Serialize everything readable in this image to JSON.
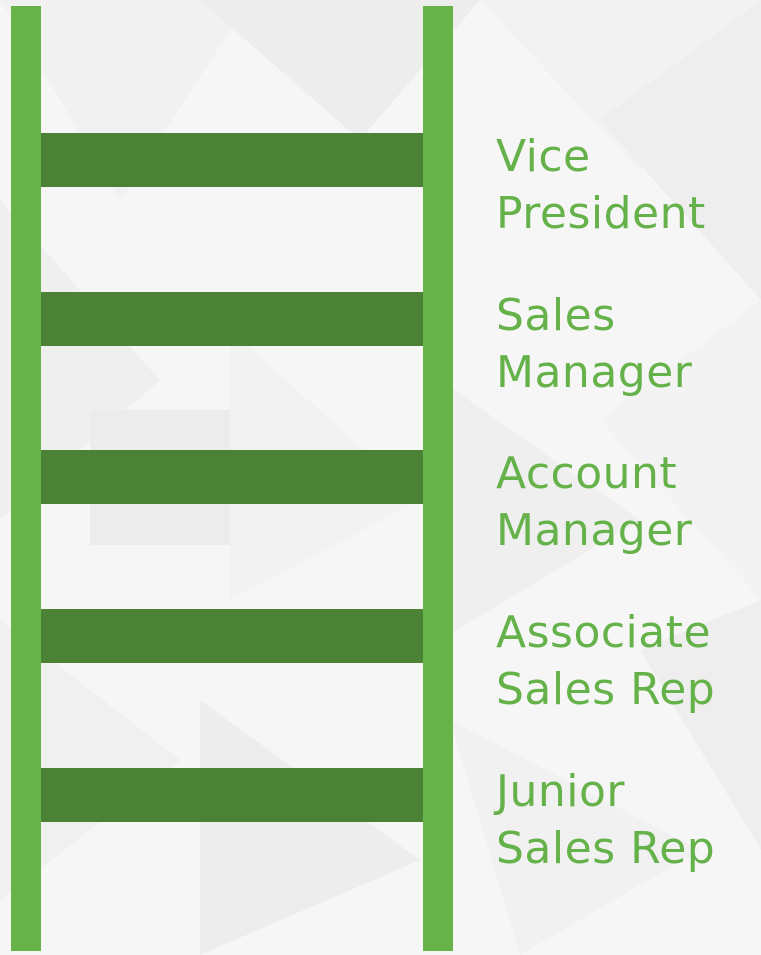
{
  "colors": {
    "rail": "#68b24a",
    "rung": "#4c8236",
    "text": "#66b24a"
  },
  "ladder": {
    "levels": [
      {
        "line1": "Vice",
        "line2": "President"
      },
      {
        "line1": "Sales",
        "line2": "Manager"
      },
      {
        "line1": "Account",
        "line2": "Manager"
      },
      {
        "line1": "Associate",
        "line2": "Sales Rep"
      },
      {
        "line1": "Junior",
        "line2": "Sales Rep"
      }
    ]
  }
}
